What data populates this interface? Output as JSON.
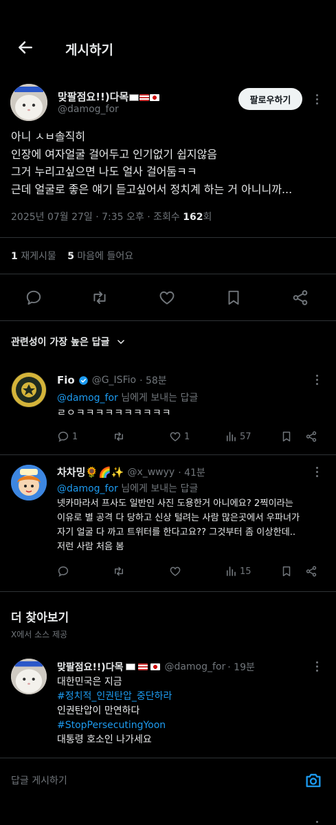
{
  "header": {
    "title": "게시하기"
  },
  "post": {
    "author_name": "맞팔점요!!)다목",
    "handle": "@damog_for",
    "follow_label": "팔로우하기",
    "lines": [
      "아니 ㅅㅂ솔직히",
      "인장에 여자얼굴 걸어두고 인기없기 쉽지않음",
      "그거 누리고싶으면 나도 얼사 걸어둠ㅋㅋ",
      "근데 얼굴로 좋은 얘기 듣고싶어서 정치계 하는 거 아니니까..."
    ],
    "meta_prefix": "2025년 07월 27일 · 7:35 오후 · 조회수 ",
    "views": "162",
    "views_suffix": "회",
    "reposts_count": "1",
    "reposts_label": "재게시물",
    "likes_count": "5",
    "likes_label": "마음에 들어요"
  },
  "sort": {
    "label": "관련성이 가장 높은 답글"
  },
  "replies": [
    {
      "name": "Fio",
      "handle": "@G_ISFio",
      "time": "· 58분",
      "reply_prefix": "@damog_for",
      "reply_suffix": " 님에게 보내는 답글",
      "text": "ㄹㅇㅋㅋㅋㅋㅋㅋㅋㅋㅋㅋ",
      "replies": "1",
      "retweets": "",
      "likes": "1",
      "views": "57"
    },
    {
      "name": "차차밍🌻🌈✨",
      "handle": "@x_wwyy",
      "time": "· 41분",
      "reply_prefix": "@damog_for",
      "reply_suffix": " 님에게 보내는 답글",
      "text_lines": [
        "넷카마라서 프사도 일반인 사진 도용한거 아니에요? 2찍이라는",
        "이유로 별 공격 다 당하고 신상 털려는 사람 많은곳에서 우파녀가",
        "자기 얼굴 다 까고 트위터를 한다고요?? 그것부터 좀 이상한데..",
        "저런 사람 처음 봄"
      ],
      "views": "15"
    }
  ],
  "explore": {
    "title": "더 찾아보기",
    "source": "X에서 소스 제공",
    "item": {
      "name": "맞팔점요!!)다목",
      "handle": "@damog_for",
      "time": "· 19분",
      "line1": "대한민국은 지금",
      "tag1": "#정치적_인권탄압_중단하라",
      "line2": "인권탄압이 만연하다",
      "tag2": "#StopPersecutingYoon",
      "line3": "대통령 호소인 나가세요"
    }
  },
  "composer": {
    "placeholder": "답글 게시하기"
  },
  "colors": {
    "accent": "#1d9bf0",
    "background": "#000000",
    "divider": "#2f3336",
    "muted": "#71767b"
  },
  "icons": [
    "back-arrow-icon",
    "more-icon",
    "reply-icon",
    "retweet-icon",
    "like-icon",
    "bookmark-icon",
    "share-icon",
    "views-icon",
    "verified-badge-icon",
    "camera-icon",
    "chevron-down-icon"
  ]
}
